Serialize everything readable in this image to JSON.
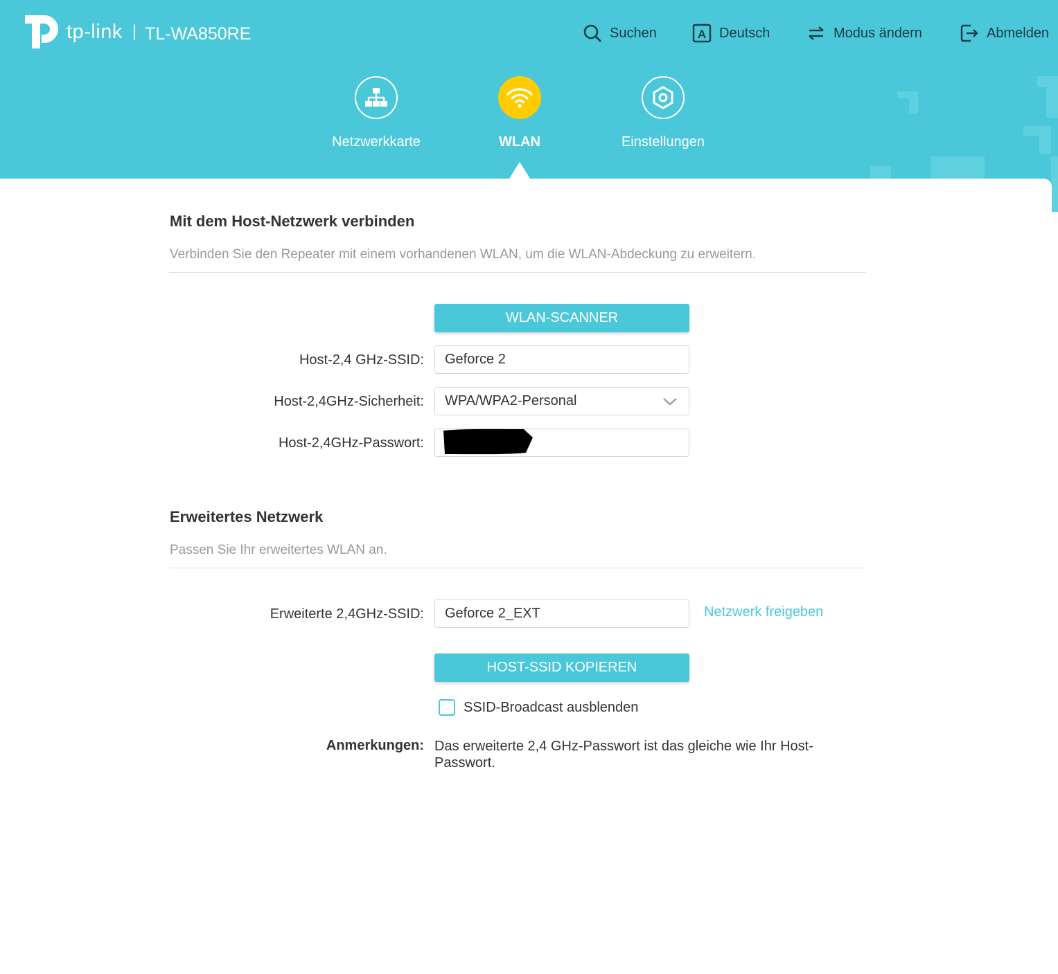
{
  "brand": {
    "name": "tp-link",
    "model": "TL-WA850RE"
  },
  "topnav": {
    "search": "Suchen",
    "language": "Deutsch",
    "mode": "Modus ändern",
    "logout": "Abmelden"
  },
  "tabs": [
    {
      "label": "Netzwerkkarte",
      "icon": "network-map-icon",
      "active": false
    },
    {
      "label": "WLAN",
      "icon": "wifi-icon",
      "active": true
    },
    {
      "label": "Einstellungen",
      "icon": "gear-icon",
      "active": false
    }
  ],
  "host_section": {
    "title": "Mit dem Host-Netzwerk verbinden",
    "description": "Verbinden Sie den Repeater mit einem vorhandenen WLAN, um die WLAN-Abdeckung zu erweitern.",
    "scanner_button": "WLAN-SCANNER",
    "ssid_label": "Host-2,4 GHz-SSID:",
    "ssid_value": "Geforce 2",
    "security_label": "Host-2,4GHz-Sicherheit:",
    "security_value": "WPA/WPA2-Personal",
    "password_label": "Host-2,4GHz-Passwort:"
  },
  "extended_section": {
    "title": "Erweitertes Netzwerk",
    "description": "Passen Sie Ihr erweitertes WLAN an.",
    "ssid_label": "Erweiterte 2,4GHz-SSID:",
    "ssid_value": "Geforce 2_EXT",
    "share_link": "Netzwerk freigeben",
    "copy_button": "HOST-SSID KOPIEREN",
    "hide_broadcast_label": "SSID-Broadcast ausblenden",
    "hide_broadcast_checked": false,
    "notes_label": "Anmerkungen:",
    "notes_text": "Das erweiterte 2,4 GHz-Passwort ist das gleiche wie Ihr Host-Passwort."
  },
  "colors": {
    "accent": "#4bc7da",
    "active_tab": "#ffcc00"
  }
}
